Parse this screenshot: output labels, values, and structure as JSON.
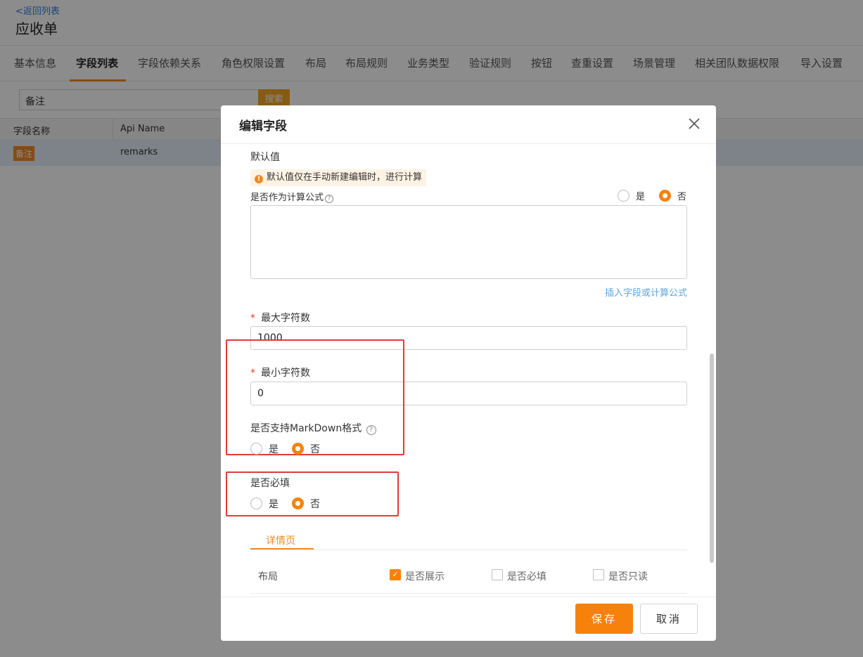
{
  "page": {
    "back_link": "<返回列表",
    "title": "应收单",
    "tabs": [
      "基本信息",
      "字段列表",
      "字段依赖关系",
      "角色权限设置",
      "布局",
      "布局规则",
      "业务类型",
      "验证规则",
      "按钮",
      "查重设置",
      "场景管理",
      "相关团队数据权限",
      "导入设置"
    ],
    "active_tab": "字段列表",
    "search_value": "备注",
    "search_button": "搜索",
    "table": {
      "headers": [
        "字段名称",
        "Api Name"
      ],
      "rows": [
        {
          "name": "备注",
          "api": "remarks"
        }
      ]
    }
  },
  "modal": {
    "title": "编辑字段",
    "default_value_label": "默认值",
    "default_value_tip": "默认值仅在手动新建编辑时，进行计算",
    "formula_label": "是否作为计算公式",
    "formula_options": [
      "是",
      "否"
    ],
    "formula_selected": "否",
    "formula_text": "",
    "insert_link": "插入字段或计算公式",
    "max_chars_label": "最大字符数",
    "max_chars_value": "1000",
    "min_chars_label": "最小字符数",
    "min_chars_value": "0",
    "markdown_label": "是否支持MarkDown格式",
    "markdown_options": [
      "是",
      "否"
    ],
    "markdown_selected": "否",
    "required_label": "是否必填",
    "required_options": [
      "是",
      "否"
    ],
    "required_selected": "否",
    "detail_tab": "详情页",
    "layout_row": {
      "label": "布局",
      "show_label": "是否展示",
      "show_checked": true,
      "required_label": "是否必填",
      "required_checked": false,
      "readonly_label": "是否只读",
      "readonly_checked": false
    },
    "save_button": "保存",
    "cancel_button": "取消"
  },
  "colors": {
    "accent": "#f7820b",
    "highlight_box": "#e03b3b",
    "link": "#5ba6e0"
  }
}
